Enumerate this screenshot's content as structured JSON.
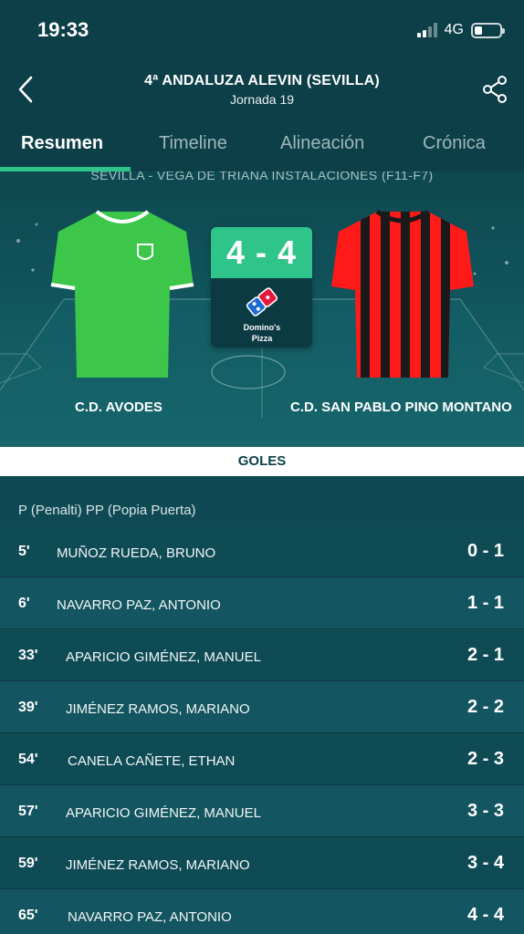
{
  "status": {
    "time": "19:33",
    "network": "4G"
  },
  "header": {
    "title": "4ª ANDALUZA ALEVIN (SEVILLA)",
    "subtitle": "Jornada 19"
  },
  "tabs": [
    {
      "label": "Resumen",
      "active": true
    },
    {
      "label": "Timeline",
      "active": false
    },
    {
      "label": "Alineación",
      "active": false
    },
    {
      "label": "Crónica",
      "active": false
    }
  ],
  "match": {
    "venue": "SEVILLA - VEGA DE TRIANA INSTALACIONES (F11-F7)",
    "score": "4 - 4",
    "home_team": "C.D. AVODES",
    "away_team": "C.D. SAN PABLO PINO MONTANO",
    "sponsor": "Domino's Pizza",
    "sponsor_line1": "Domino's",
    "sponsor_line2": "Pizza",
    "colors": {
      "home_shirt": "#3cc74a",
      "away_red": "#ff1a1a",
      "away_black": "#1a1a1a",
      "accent": "#2fc58a"
    }
  },
  "goals": {
    "title": "GOLES",
    "legend": "P (Penalti) PP (Popia Puerta)",
    "items": [
      {
        "minute": "5'",
        "player": "MUÑOZ RUEDA, BRUNO",
        "score": "0 - 1"
      },
      {
        "minute": "6'",
        "player": "NAVARRO PAZ, ANTONIO",
        "score": "1 - 1"
      },
      {
        "minute": "33'",
        "player": "APARICIO GIMÉNEZ, MANUEL",
        "score": "2 - 1"
      },
      {
        "minute": "39'",
        "player": "JIMÉNEZ RAMOS, MARIANO",
        "score": "2 - 2"
      },
      {
        "minute": "54'",
        "player": "CANELA CAÑETE, ETHAN",
        "score": "2 - 3"
      },
      {
        "minute": "57'",
        "player": "APARICIO GIMÉNEZ, MANUEL",
        "score": "3 - 3"
      },
      {
        "minute": "59'",
        "player": "JIMÉNEZ RAMOS, MARIANO",
        "score": "3 - 4"
      },
      {
        "minute": "65'",
        "player": "NAVARRO PAZ, ANTONIO",
        "score": "4 - 4"
      }
    ]
  }
}
